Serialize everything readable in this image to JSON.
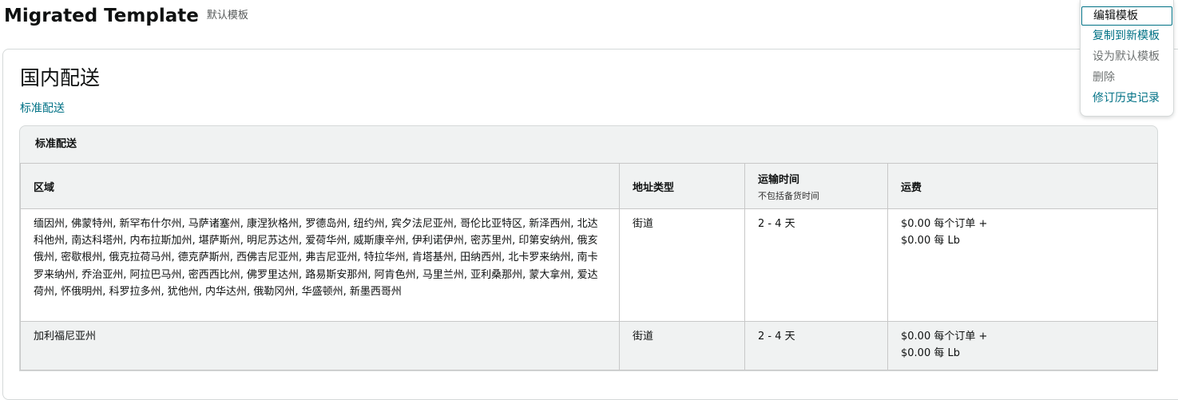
{
  "header": {
    "title": "Migrated Template",
    "subtitle": "默认模板"
  },
  "menu": {
    "items": [
      {
        "label": "编辑模板"
      },
      {
        "label": "复制到新模板"
      },
      {
        "label": "设为默认模板"
      },
      {
        "label": "删除"
      },
      {
        "label": "修订历史记录"
      }
    ]
  },
  "section": {
    "title": "国内配送",
    "link": "标准配送"
  },
  "table": {
    "caption": "标准配送",
    "headers": {
      "region": "区域",
      "address_type": "地址类型",
      "transit_time": "运输时间",
      "transit_note": "不包括备货时间",
      "fee": "运费"
    },
    "rows": [
      {
        "region": "缅因州, 佛蒙特州, 新罕布什尔州, 马萨诸塞州, 康涅狄格州, 罗德岛州, 纽约州, 宾夕法尼亚州, 哥伦比亚特区, 新泽西州, 北达科他州, 南达科塔州, 内布拉斯加州, 堪萨斯州, 明尼苏达州, 爱荷华州, 威斯康辛州, 伊利诺伊州, 密苏里州, 印第安纳州, 俄亥俄州, 密歇根州, 俄克拉荷马州, 德克萨斯州, 西佛吉尼亚州, 弗吉尼亚州, 特拉华州, 肯塔基州, 田纳西州, 北卡罗来纳州, 南卡罗来纳州, 乔治亚州, 阿拉巴马州, 密西西比州, 佛罗里达州, 路易斯安那州, 阿肯色州, 马里兰州, 亚利桑那州, 蒙大拿州, 爱达荷州, 怀俄明州, 科罗拉多州, 犹他州, 内华达州, 俄勒冈州, 华盛顿州, 新墨西哥州",
        "address_type": "街道",
        "transit_time": "2 - 4 天",
        "fee_line1": "$0.00 每个订单 +",
        "fee_line2": "$0.00 每 Lb"
      },
      {
        "region": "加利福尼亚州",
        "address_type": "街道",
        "transit_time": "2 - 4 天",
        "fee_line1": "$0.00 每个订单 +",
        "fee_line2": "$0.00 每 Lb"
      }
    ]
  }
}
